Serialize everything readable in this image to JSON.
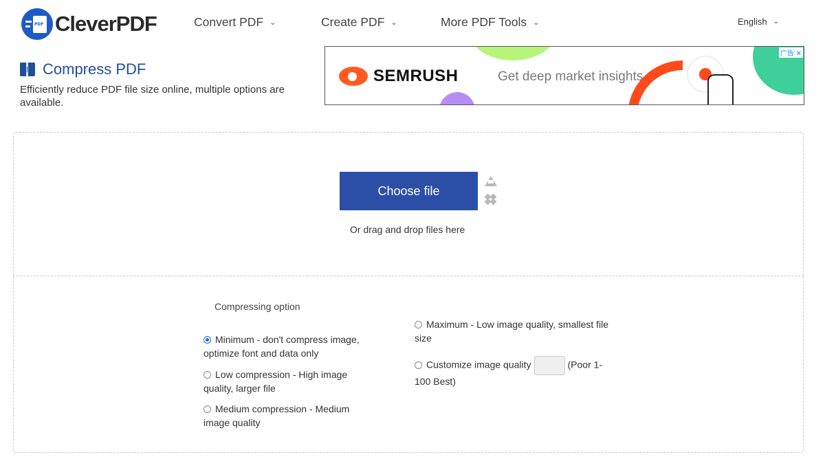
{
  "brand": {
    "name": "CleverPDF",
    "logo_badge": "PDF"
  },
  "nav": {
    "convert": "Convert PDF",
    "create": "Create PDF",
    "more": "More PDF Tools",
    "language": "English"
  },
  "page": {
    "title": "Compress PDF",
    "description": "Efficiently reduce PDF file size online, multiple options are available."
  },
  "ad": {
    "brand": "SEMRUSH",
    "tagline": "Get deep market insights",
    "badge": "广告 ✕"
  },
  "upload": {
    "button": "Choose file",
    "drag_text": "Or drag and drop files here"
  },
  "options": {
    "title": "Compressing option",
    "minimum": "Minimum - don't compress image, optimize font and data only",
    "low": "Low compression - High image quality, larger file",
    "medium": "Medium compression - Medium image quality",
    "maximum": "Maximum - Low image quality, smallest file size",
    "custom": "Customize image quality",
    "custom_hint": "(Poor 1-100 Best)",
    "selected": "minimum"
  },
  "colors": {
    "brand_blue": "#1f5bc6",
    "title_blue": "#1f4f9a",
    "button_blue": "#2b4fa6"
  }
}
